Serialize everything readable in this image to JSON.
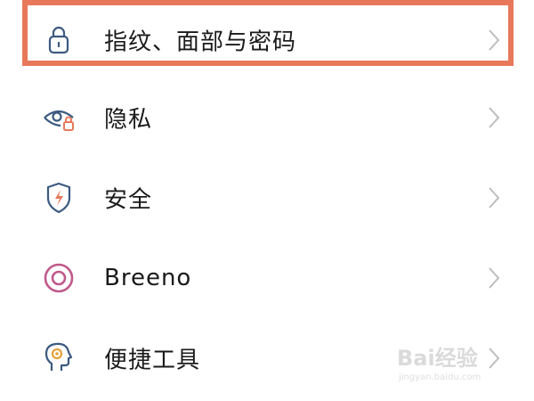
{
  "settings": {
    "items": [
      {
        "label": "指纹、面部与密码",
        "icon": "lock-icon"
      },
      {
        "label": "隐私",
        "icon": "privacy-eye-icon"
      },
      {
        "label": "安全",
        "icon": "security-shield-icon"
      },
      {
        "label": "Breeno",
        "icon": "breeno-icon"
      },
      {
        "label": "便捷工具",
        "icon": "convenience-tools-icon"
      }
    ]
  },
  "watermark": {
    "logo_text": "Bai经验",
    "url_text": "jingyan.baidu.com"
  },
  "colors": {
    "highlight": "#e8785a",
    "icon_blue": "#3d5a80",
    "breeno": "#c0598c",
    "tools_orange": "#e6a13a"
  }
}
